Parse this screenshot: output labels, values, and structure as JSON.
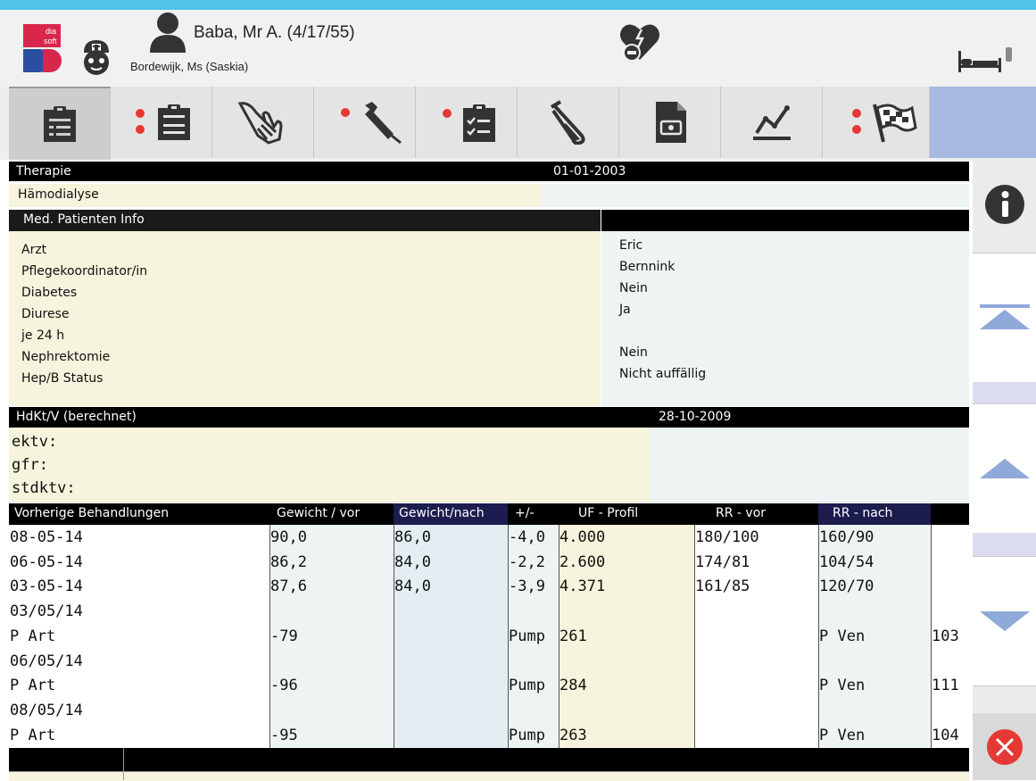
{
  "header": {
    "logo_text_top": "dia",
    "logo_text_bottom": "soft",
    "patient_name": "Baba, Mr A. (4/17/55)",
    "nurse_name": "Bordewijk, Ms (Saskia)"
  },
  "toolbar": {
    "tabs": [
      {
        "icon": "clipboard-list-icon",
        "dot": false
      },
      {
        "icon": "clipboard-icon",
        "dot": true
      },
      {
        "icon": "hand-icon",
        "dot": false
      },
      {
        "icon": "syringe-icon",
        "dot": true
      },
      {
        "icon": "clipboard-check-icon",
        "dot": true
      },
      {
        "icon": "test-tube-icon",
        "dot": false
      },
      {
        "icon": "document-medical-icon",
        "dot": false
      },
      {
        "icon": "line-chart-icon",
        "dot": false
      },
      {
        "icon": "checkered-flag-icon",
        "dot": true
      }
    ]
  },
  "therapie": {
    "label": "Therapie",
    "date": "01-01-2003",
    "value": "Hämodialyse"
  },
  "med_info": {
    "label": "Med. Patienten Info",
    "rows": [
      {
        "label": "Arzt",
        "value": "Eric"
      },
      {
        "label": "Pflegekoordinator/in",
        "value": "Bernnink"
      },
      {
        "label": "Diabetes",
        "value": "Nein"
      },
      {
        "label": "Diurese",
        "value": "Ja"
      },
      {
        "label": "je 24 h",
        "value": ""
      },
      {
        "label": "Nephrektomie",
        "value": "Nein"
      },
      {
        "label": "Hep/B Status",
        "value": "Nicht auffällig"
      }
    ]
  },
  "hdktv": {
    "label": "HdKt/V (berechnet)",
    "date": "28-10-2009",
    "lines": [
      "ektv:",
      "gfr:",
      "stdktv:"
    ]
  },
  "previous": {
    "headers": [
      "Vorherige Behandlungen",
      "Gewicht / vor",
      "Gewicht/nach",
      "+/-",
      "UF - Profil",
      "RR - vor",
      "RR - nach"
    ],
    "rows": [
      [
        "08-05-14",
        "90,0",
        "86,0",
        "-4,0",
        "4.000",
        "180/100",
        "160/90",
        ""
      ],
      [
        "06-05-14",
        "86,2",
        "84,0",
        "-2,2",
        "2.600",
        "174/81",
        "104/54",
        ""
      ],
      [
        "03-05-14",
        "87,6",
        "84,0",
        "-3,9",
        "4.371",
        "161/85",
        "120/70",
        ""
      ],
      [
        "03/05/14",
        "",
        "",
        "",
        "",
        "",
        "",
        ""
      ],
      [
        "P Art",
        "-79",
        "",
        "Pump",
        "261",
        "",
        "P Ven",
        "103"
      ],
      [
        "06/05/14",
        "",
        "",
        "",
        "",
        "",
        "",
        ""
      ],
      [
        "P Art",
        "-96",
        "",
        "Pump",
        "284",
        "",
        "P Ven",
        "111"
      ],
      [
        "08/05/14",
        "",
        "",
        "",
        "",
        "",
        "",
        ""
      ],
      [
        "P Art",
        "-95",
        "",
        "Pump",
        "263",
        "",
        "P Ven",
        "104"
      ]
    ]
  },
  "colors": {
    "top_accent": "#4fc3e8",
    "beige": "#f6f4dc",
    "light_blue_cell": "#eef4f4",
    "header_navy": "#1c1c4e",
    "arrow_blue": "#8fa9d8",
    "close_red": "#e53935",
    "dot_red": "#e53935"
  }
}
